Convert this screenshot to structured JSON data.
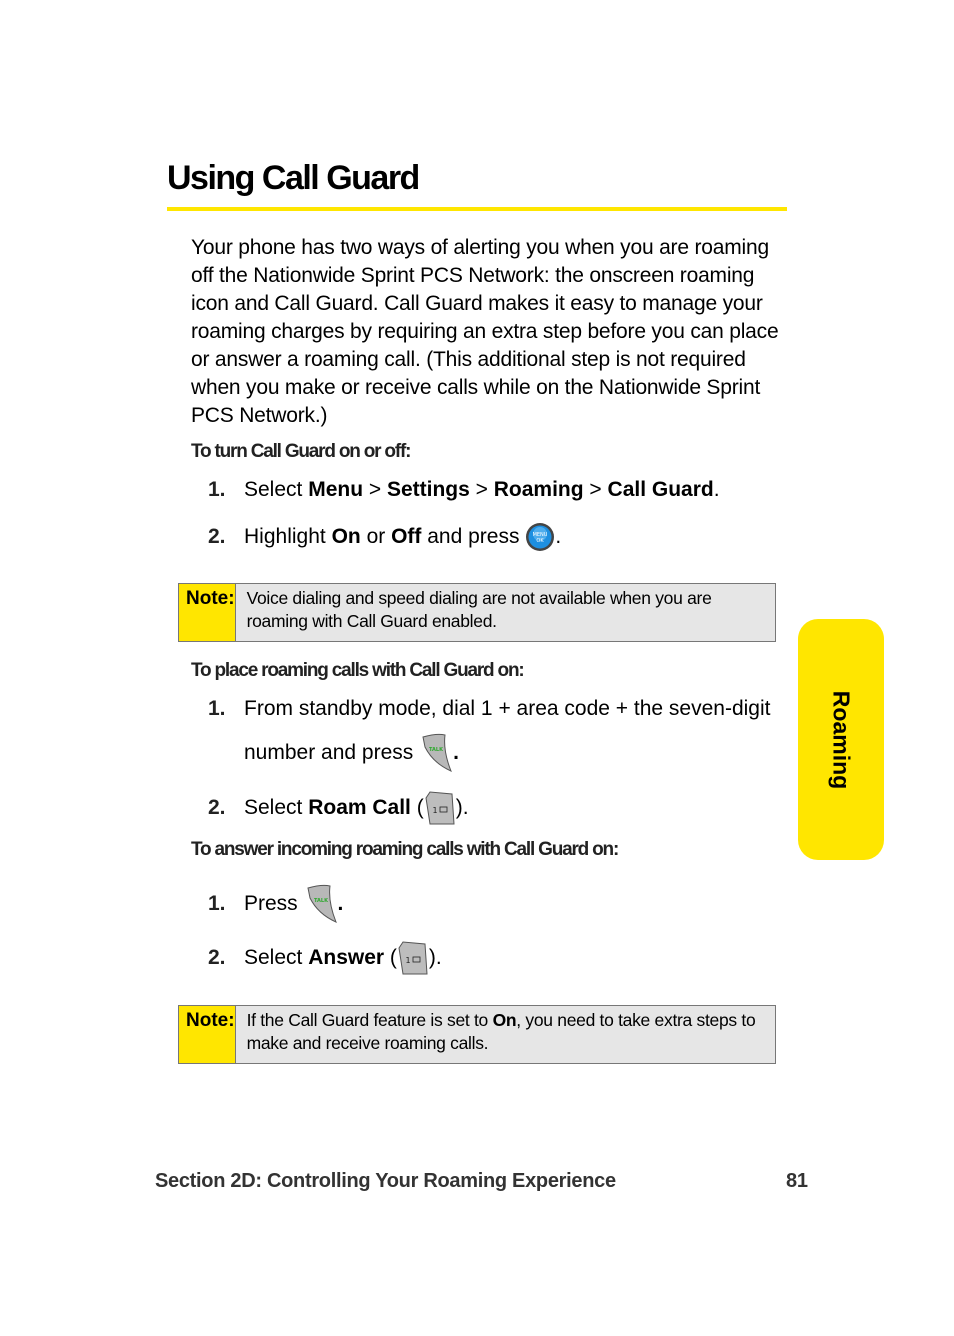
{
  "page": {
    "title": "Using Call Guard",
    "intro": "Your phone has two ways of alerting you when you are roaming off the Nationwide Sprint PCS Network: the onscreen roaming icon and Call Guard. Call Guard makes it easy to manage your roaming charges by requiring an extra step before you can place or answer a roaming call. (This additional step is not required when you make or receive calls while on the Nationwide Sprint PCS Network.)"
  },
  "section1": {
    "heading": "To turn Call Guard on or off:",
    "steps": [
      {
        "num": "1.",
        "pre": "Select ",
        "menu": "Menu",
        "sep1": " > ",
        "settings": "Settings",
        "sep2": " > ",
        "roaming": "Roaming",
        "sep3": " > ",
        "callguard": "Call Guard",
        "post": "."
      },
      {
        "num": "2.",
        "pre": "Highlight ",
        "on": "On",
        "mid": " or ",
        "off": "Off",
        "post": " and press ",
        "end": ".",
        "icon": "menu-ok-key-icon"
      }
    ]
  },
  "note1": {
    "label": "Note:",
    "text": "Voice dialing and speed dialing are not available when you are roaming with Call Guard enabled."
  },
  "section2": {
    "heading": "To place roaming calls with Call Guard on:",
    "steps": [
      {
        "num": "1.",
        "line1": "From standby mode, dial 1 + area code + the seven-digit",
        "line2": "number and press ",
        "end": ".",
        "icon": "talk-key-icon"
      },
      {
        "num": "2.",
        "pre": "Select ",
        "bold": "Roam Call",
        "open": " (",
        "close": ").",
        "icon": "one-key-icon"
      }
    ]
  },
  "section3": {
    "heading": "To answer incoming roaming calls with Call Guard on:",
    "steps": [
      {
        "num": "1.",
        "pre": "Press ",
        "end": ".",
        "icon": "talk-key-icon"
      },
      {
        "num": "2.",
        "pre": "Select ",
        "bold": "Answer",
        "open": " (",
        "close": ").",
        "icon": "one-key-icon"
      }
    ]
  },
  "note2": {
    "label": "Note:",
    "pre": "If the Call Guard feature is set to ",
    "bold": "On",
    "post": ", you need to take extra steps to make and receive roaming calls."
  },
  "side_tab": {
    "label": "Roaming"
  },
  "footer": {
    "section": "Section 2D: Controlling Your Roaming Experience",
    "page_number": "81"
  },
  "icon_labels": {
    "menu_top": "MENU",
    "menu_bottom": "OK",
    "talk": "TALK",
    "one": "1"
  },
  "colors": {
    "accent": "#FFE600",
    "note_bg": "#E6E6E6",
    "talk_green": "#2EA82E",
    "menu_blue": "#1E8FE0"
  }
}
